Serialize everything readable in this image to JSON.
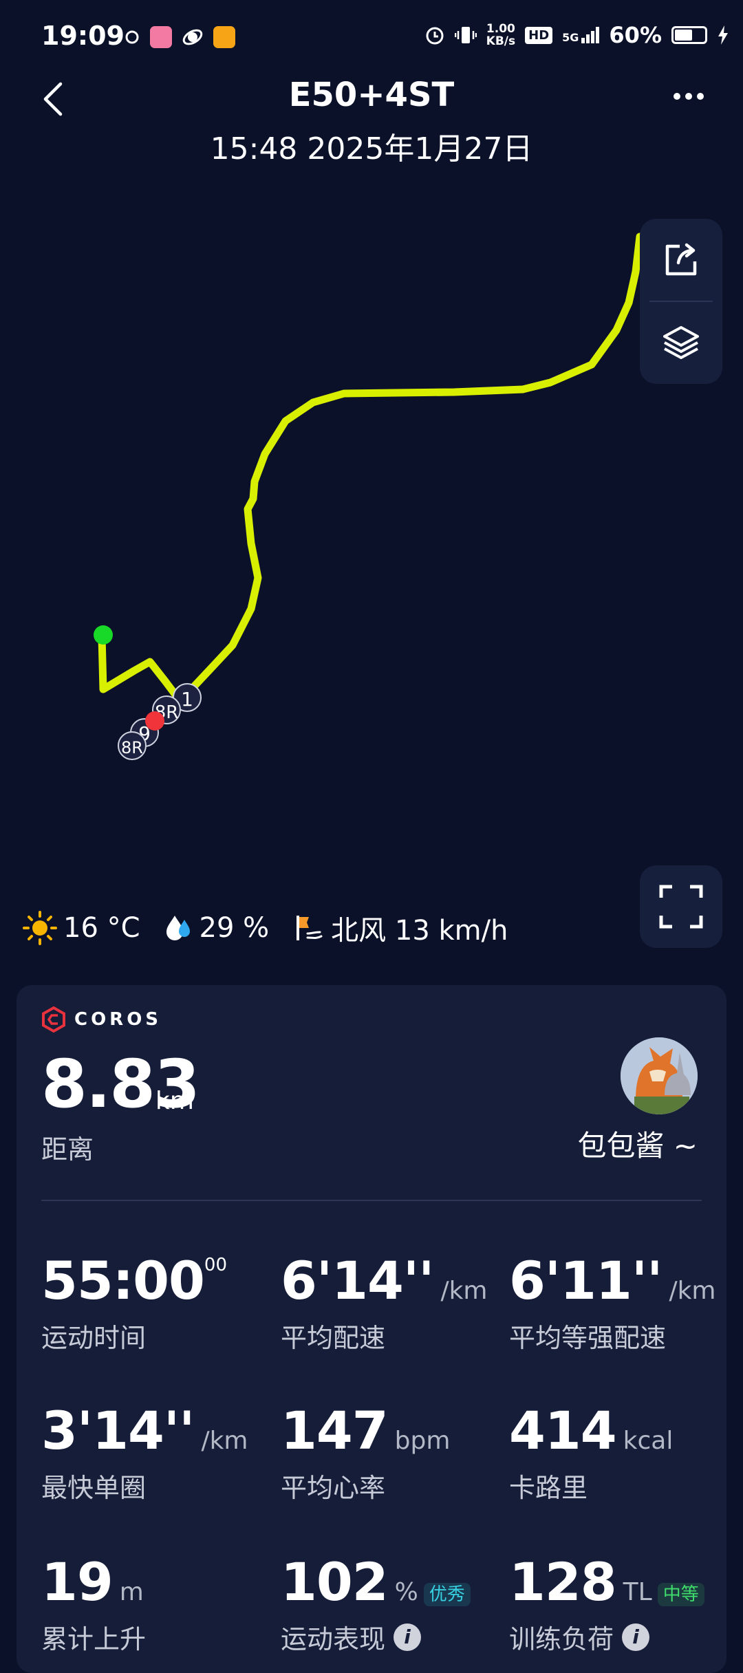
{
  "status_bar": {
    "time": "19:09",
    "net_speed_top": "1.00",
    "net_speed_bottom": "KB/s",
    "hd": "HD",
    "signal": "5G",
    "battery": "60%",
    "battery_level": 0.6
  },
  "header": {
    "title": "E50+4ST",
    "datetime": "15:48 2025年1月27日"
  },
  "map": {
    "route_color": "#d8f000",
    "start_color": "#18d828",
    "end_color": "#f0343a",
    "lap_markers": [
      "1",
      "8R",
      "9",
      "8R"
    ]
  },
  "weather": {
    "temp": "16 °C",
    "humidity": "29  %",
    "wind": "北风 13 km/h"
  },
  "card": {
    "brand": "COROS",
    "distance": "8.83",
    "distance_unit": "km",
    "distance_label": "距离",
    "username": "包包酱 ~",
    "stats": [
      {
        "value": "55:00",
        "sup": "00",
        "unit": "",
        "label": "运动时间"
      },
      {
        "value": "6'14''",
        "unit": "/km",
        "label": "平均配速"
      },
      {
        "value": "6'11''",
        "unit": "/km",
        "label": "平均等强配速"
      },
      {
        "value": "3'14''",
        "unit": "/km",
        "label": "最快单圈"
      },
      {
        "value": "147",
        "unit": "bpm",
        "label": "平均心率"
      },
      {
        "value": "414",
        "unit": "kcal",
        "label": "卡路里"
      },
      {
        "value": "19",
        "unit": "m",
        "label": "累计上升"
      },
      {
        "value": "102",
        "unit": "%",
        "badge": "优秀",
        "label": "运动表现"
      },
      {
        "value": "128",
        "unit": "TL",
        "badge": "中等",
        "label": "训练负荷"
      }
    ],
    "badge_colors": {
      "excellent": "#37d0e0",
      "medium": "#3fdc6c"
    }
  }
}
